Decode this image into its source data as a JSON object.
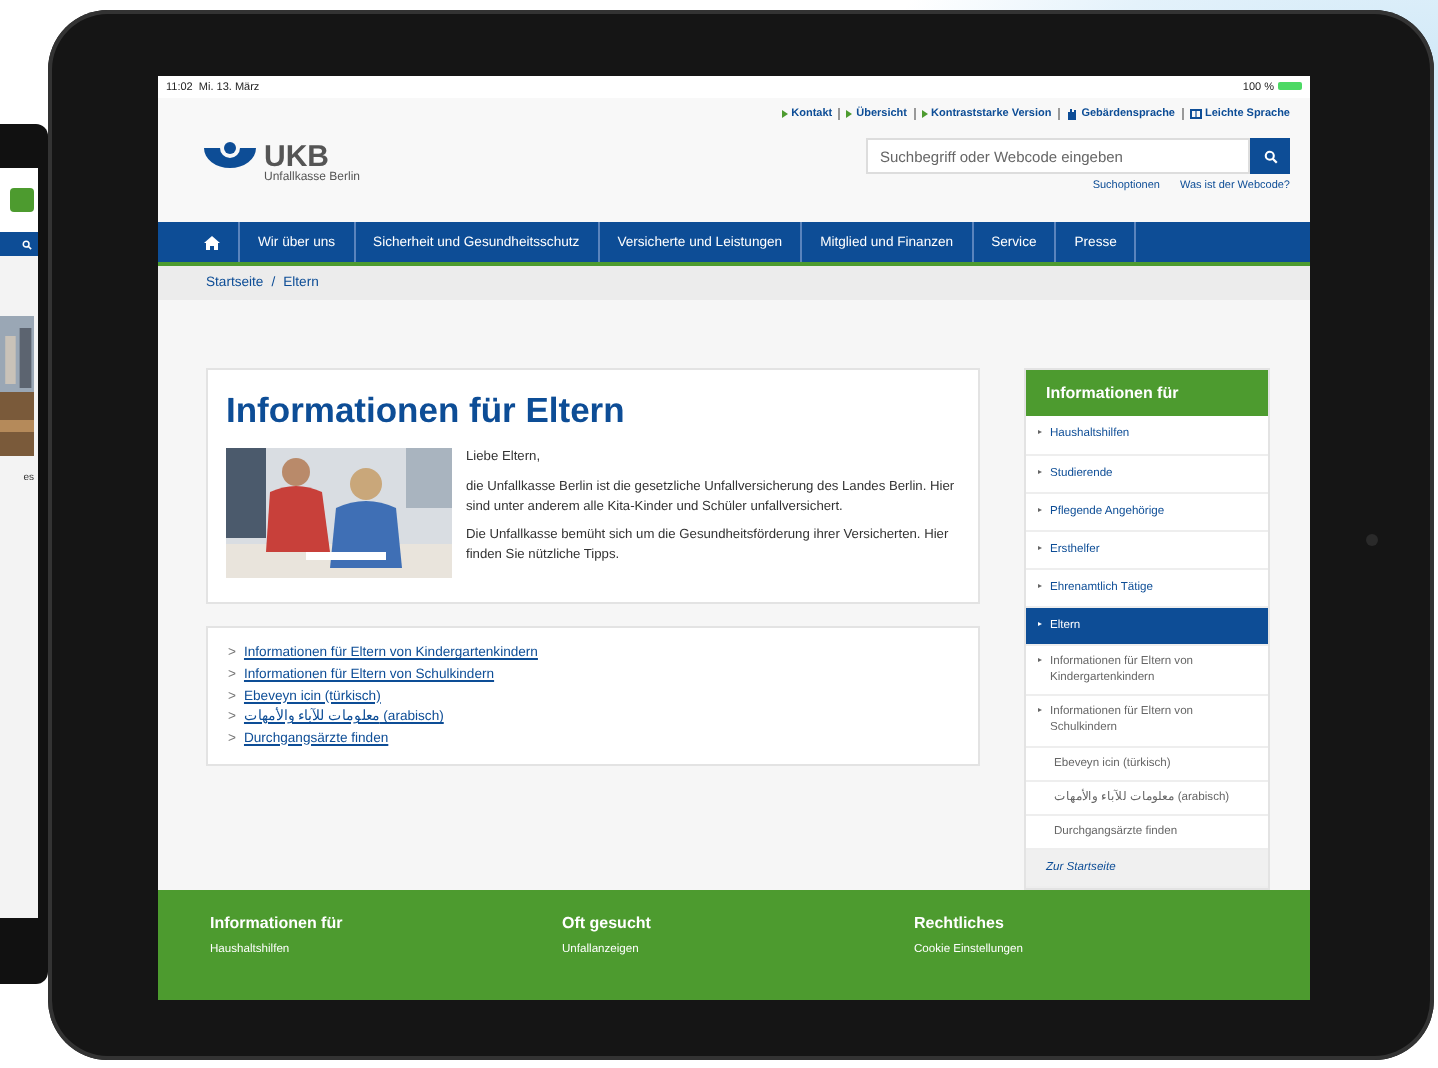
{
  "phone": {
    "text_fragment": "es"
  },
  "status_bar": {
    "time": "11:02",
    "date": "Mi. 13. März",
    "battery": "100 %"
  },
  "top_links": [
    {
      "label": "Kontakt",
      "kind": "arrow"
    },
    {
      "label": "Übersicht",
      "kind": "arrow"
    },
    {
      "label": "Kontraststarke Version",
      "kind": "arrow"
    },
    {
      "label": "Gebärdensprache",
      "kind": "hand"
    },
    {
      "label": "Leichte Sprache",
      "kind": "book"
    }
  ],
  "logo": {
    "name": "UKB",
    "subtitle": "Unfallkasse Berlin"
  },
  "search": {
    "placeholder": "Suchbegriff oder Webcode eingeben",
    "links": [
      "Suchoptionen",
      "Was ist der Webcode?"
    ]
  },
  "nav": [
    "Wir über uns",
    "Sicherheit und Gesundheitsschutz",
    "Versicherte und Leistungen",
    "Mitglied und Finanzen",
    "Service",
    "Presse"
  ],
  "breadcrumb": {
    "items": [
      "Startseite",
      "Eltern"
    ],
    "separator": "/"
  },
  "article": {
    "title": "Informationen für Eltern",
    "paragraphs": [
      "Liebe Eltern,",
      "die Unfallkasse Berlin ist die gesetzliche Unfallversicherung des Landes Berlin. Hier sind unter anderem alle Kita-Kinder und Schüler unfallversichert.",
      "Die Unfallkasse bemüht sich um die Gesundheitsförderung ihrer Versicherten. Hier finden Sie nützliche Tipps."
    ]
  },
  "links": {
    "marker": ">",
    "items": [
      "Informationen für Eltern von Kindergartenkindern",
      "Informationen für Eltern von Schulkindern",
      "Ebeveyn icin (türkisch)",
      "معلومات للآباء والأمهات (arabisch)",
      "Durchgangsärzte finden"
    ]
  },
  "sidebar": {
    "title": "Informationen für",
    "items": [
      {
        "label": "Haushaltshilfen",
        "selected": false,
        "kind": "bullet"
      },
      {
        "label": "Studierende",
        "selected": false,
        "kind": "bullet"
      },
      {
        "label": "Pflegende Angehörige",
        "selected": false,
        "kind": "bullet"
      },
      {
        "label": "Ersthelfer",
        "selected": false,
        "kind": "bullet"
      },
      {
        "label": "Ehrenamtlich Tätige",
        "selected": false,
        "kind": "bullet"
      },
      {
        "label": "Eltern",
        "selected": true,
        "kind": "bullet",
        "children": [
          {
            "label": "Informationen für Eltern von Kindergartenkindern",
            "kind": "bullet"
          },
          {
            "label": "Informationen für Eltern von Schulkindern",
            "kind": "bullet"
          },
          {
            "label": "Ebeveyn icin (türkisch)",
            "kind": "plain"
          },
          {
            "label": "معلومات للآباء والأمهات (arabisch)",
            "kind": "plain"
          },
          {
            "label": "Durchgangsärzte finden",
            "kind": "plain"
          }
        ]
      },
      {
        "label": "Zur Startseite",
        "selected": false,
        "kind": "home"
      }
    ]
  },
  "footer": [
    {
      "title": "Informationen für",
      "item": "Haushaltshilfen"
    },
    {
      "title": "Oft gesucht",
      "item": "Unfallanzeigen"
    },
    {
      "title": "Rechtliches",
      "item": "Cookie Einstellungen"
    }
  ]
}
